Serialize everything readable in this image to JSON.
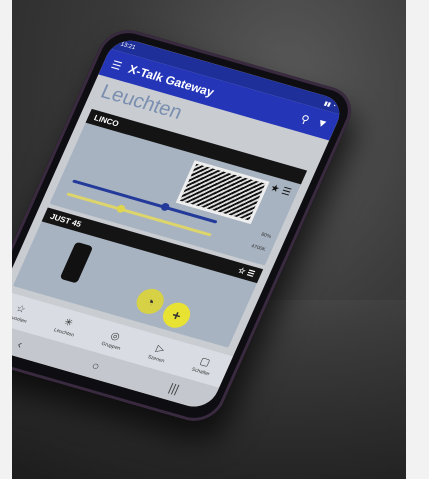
{
  "statusbar": {
    "time": "13:21"
  },
  "appbar": {
    "title": "X-Talk Gateway",
    "menu_icon": "menu-icon",
    "search_icon": "search-icon",
    "filter_icon": "filter-icon"
  },
  "page": {
    "title": "Leuchten"
  },
  "cards": [
    {
      "name": "LINCO",
      "sliders": [
        {
          "label": "",
          "value": ""
        },
        {
          "label": "",
          "value": ""
        }
      ]
    },
    {
      "name": "JUST 45",
      "slider_values": [
        "80%",
        "4700K"
      ]
    }
  ],
  "nav": {
    "items": [
      {
        "label": "Favoriten",
        "icon": "star-icon"
      },
      {
        "label": "Leuchten",
        "icon": "bulb-icon"
      },
      {
        "label": "Gruppen",
        "icon": "group-icon"
      },
      {
        "label": "Szenen",
        "icon": "play-icon"
      },
      {
        "label": "Schalter",
        "icon": "switch-icon"
      }
    ]
  },
  "colors": {
    "appbar": "#2435b8",
    "accent_yellow": "#e8e233",
    "slider_blue": "#233a9a"
  }
}
